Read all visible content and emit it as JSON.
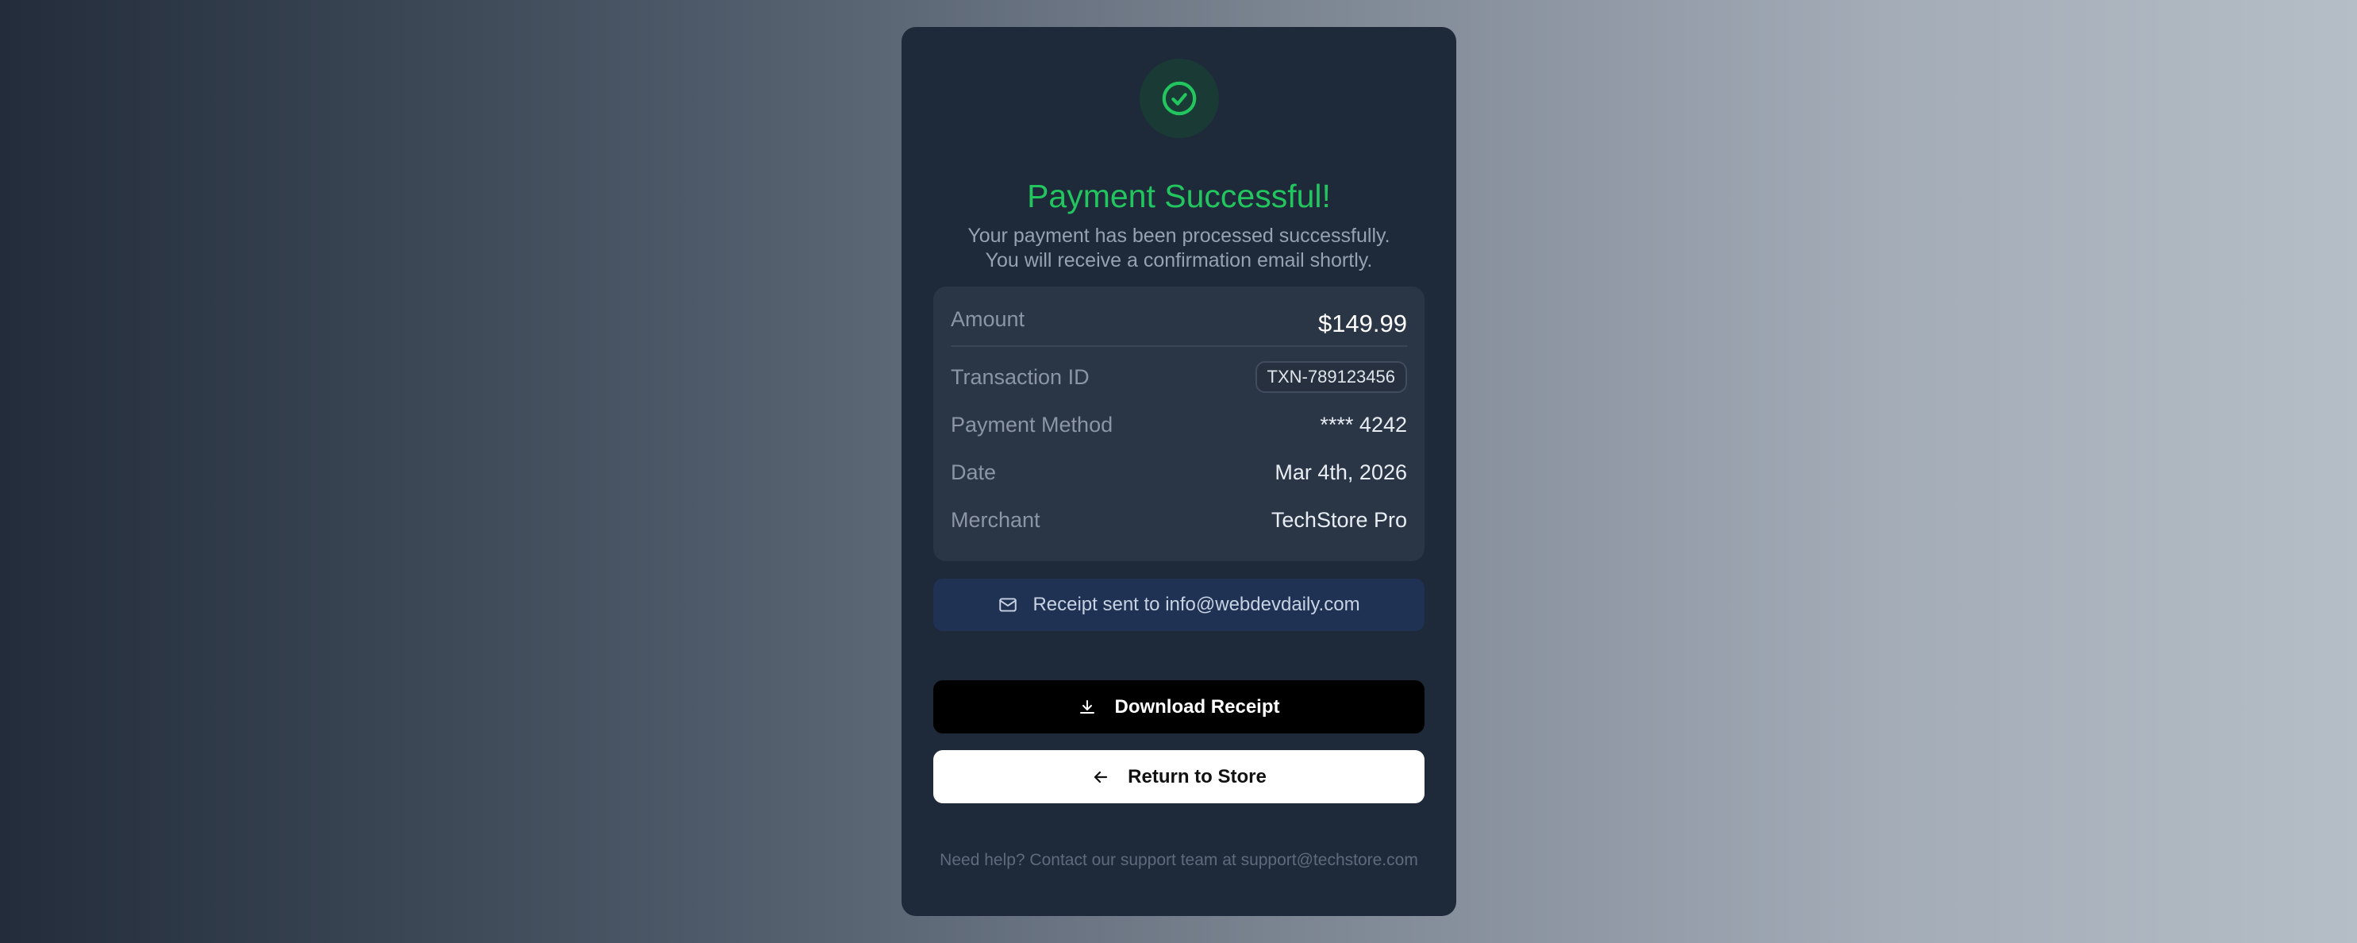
{
  "title": "Payment Successful!",
  "subtitle_line1": "Your payment has been processed successfully.",
  "subtitle_line2": "You will receive a confirmation email shortly.",
  "details": {
    "amount": {
      "label": "Amount",
      "value": "$149.99"
    },
    "transaction": {
      "label": "Transaction ID",
      "value": "TXN-789123456"
    },
    "method": {
      "label": "Payment Method",
      "value": "**** 4242"
    },
    "date": {
      "label": "Date",
      "value": "Mar 4th, 2026"
    },
    "merchant": {
      "label": "Merchant",
      "value": "TechStore Pro"
    }
  },
  "receipt_notice": "Receipt sent to info@webdevdaily.com",
  "buttons": {
    "download": "Download Receipt",
    "return": "Return to Store"
  },
  "help_text": "Need help? Contact our support team at support@techstore.com",
  "icons": {
    "success": "check-circle-icon",
    "mail": "mail-icon",
    "download": "download-icon",
    "back": "arrow-left-icon"
  },
  "colors": {
    "accent_green": "#22c55e",
    "card_bg": "#1e293a",
    "details_bg": "#2a3545",
    "receipt_bg": "#1f3254"
  }
}
